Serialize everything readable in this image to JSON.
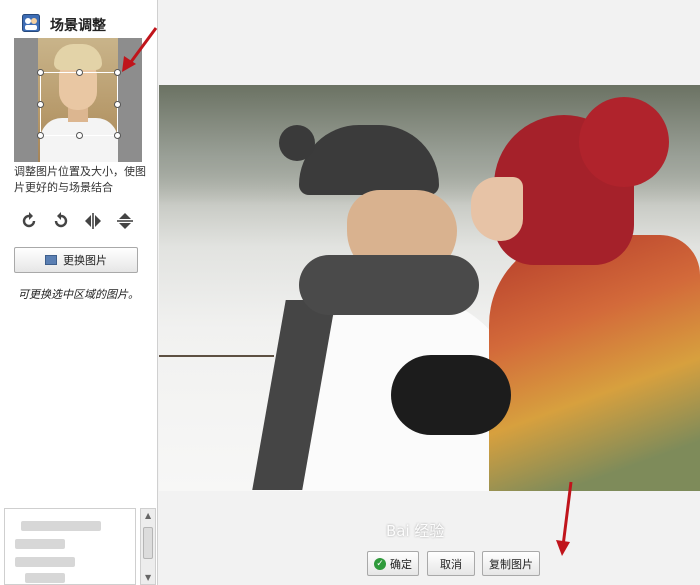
{
  "panel": {
    "title": "场景调整",
    "hint": "调整图片位置及大小，使图片更好的与场景结合",
    "replace_button": "更换图片",
    "note": "可更换选中区域的图片。"
  },
  "tools": [
    {
      "icon": "rotate-left-icon"
    },
    {
      "icon": "rotate-right-icon"
    },
    {
      "icon": "flip-horizontal-icon"
    },
    {
      "icon": "flip-vertical-icon"
    }
  ],
  "actions": {
    "ok": "确定",
    "cancel": "取消",
    "copy": "复制图片"
  },
  "watermark": "Bai 经验",
  "colors": {
    "annotation_arrow": "#c0141b",
    "ok_check": "#2f9a3b"
  }
}
